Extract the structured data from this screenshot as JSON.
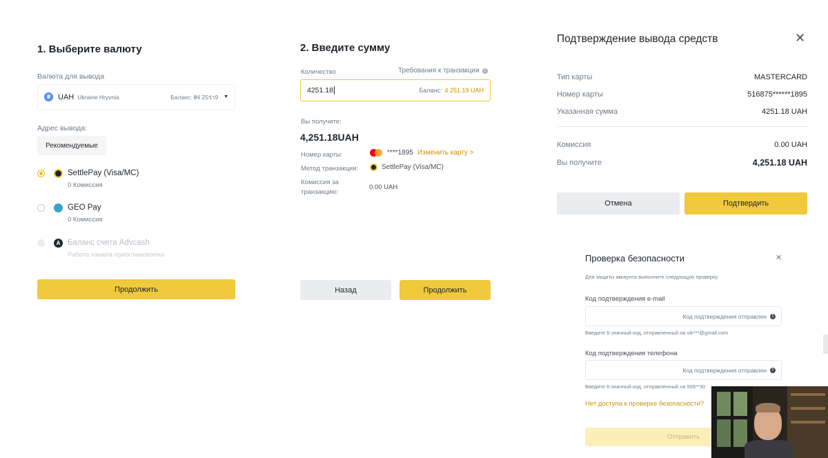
{
  "step1": {
    "title": "1. Выберите валюту",
    "currency_label": "Валюта для вывода",
    "currency_code": "UAH",
    "currency_name": "Ukraine Hryvnia",
    "balance_text": "Баланс: ₴4 25ร่า9",
    "address_label": "Адрес вывода:",
    "tag_recommended": "Рекомендуемые",
    "methods": [
      {
        "name": "SettlePay (Visa/MC)",
        "fee": "0 Комиссия",
        "icon": "settlepay-icon"
      },
      {
        "name": "GEO Pay",
        "fee": "0 Комиссия",
        "icon": "geopay-icon"
      },
      {
        "name": "Баланс счета Advcash",
        "fee": "Работа канала приостановлена",
        "icon": "advcash-icon"
      }
    ],
    "continue_label": "Продолжить"
  },
  "step2": {
    "title": "2. Введите сумму",
    "amount_label": "Количество",
    "requirements_label": "Требования к транзакции",
    "amount_value": "4251.18",
    "balance_prefix": "Баланс:",
    "balance_value": "4 251.19 UAH",
    "receive_label": "Вы получите:",
    "receive_value": "4,251.18UAH",
    "card_label": "Номер карты:",
    "card_value": "****1895",
    "change_card": "Изменить карту >",
    "method_label": "Метод транзакции:",
    "method_value": "SettlePay (Visa/MC)",
    "fee_label": "Комиссия за транзакцию:",
    "fee_value": "0.00 UAH",
    "back_label": "Назад",
    "continue_label": "Продолжить"
  },
  "confirm": {
    "title": "Подтверждение вывода средств",
    "rows": [
      {
        "label": "Тип карты",
        "value": "MASTERCARD"
      },
      {
        "label": "Номер карты",
        "value": "516875******1895"
      },
      {
        "label": "Указанная сумма",
        "value": "4251.18 UAH"
      }
    ],
    "fee_label": "Комиссия",
    "fee_value": "0.00 UAH",
    "receive_label": "Вы получите",
    "receive_value": "4,251.18 UAH",
    "cancel_label": "Отмена",
    "confirm_label": "Подтвердить"
  },
  "security": {
    "title": "Проверка безопасности",
    "subtitle": "Для защиты аккаунта выполните следующую проверку.",
    "email_label": "Код подтверждения e-mail",
    "email_placeholder": "Код подтверждения отправлен",
    "email_hint": "Введите 6-значный код, отправленный на vik***@gmail.com",
    "phone_label": "Код подтверждения телефона",
    "phone_placeholder": "Код подтверждения отправлен",
    "phone_hint": "Введите 6-значный код, отправленный на 506**30",
    "no_access": "Нет доступа к проверке безопасности?",
    "submit_label": "Отправить"
  },
  "colors": {
    "accent": "#f0c93c",
    "link": "#c99400",
    "text": "#1e2329",
    "muted": "#707a8a"
  }
}
